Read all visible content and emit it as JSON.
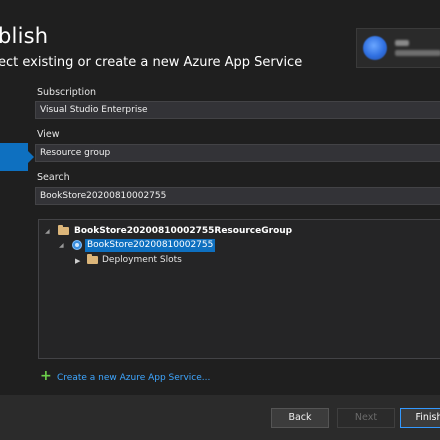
{
  "dialog": {
    "title": "blish",
    "subtitle": "ect existing or create a new Azure App Service"
  },
  "form": {
    "subscription_label": "Subscription",
    "subscription_value": "Visual Studio Enterprise",
    "view_label": "View",
    "view_value": "Resource group",
    "search_label": "Search",
    "search_value": "BookStore20200810002755"
  },
  "tree": {
    "group": {
      "label": "BookStore20200810002755ResourceGroup",
      "expanded": true
    },
    "app": {
      "label": "BookStore20200810002755",
      "selected": true
    },
    "slots": {
      "label": "Deployment Slots",
      "expanded": false
    }
  },
  "actions": {
    "create_link": "Create a new Azure App Service...",
    "back": "Back",
    "next": "Next",
    "finish": "Finish"
  },
  "colors": {
    "accent": "#0e70c0",
    "link": "#3ea6ff",
    "plus": "#6ccf4a",
    "folder": "#dcb67a"
  }
}
